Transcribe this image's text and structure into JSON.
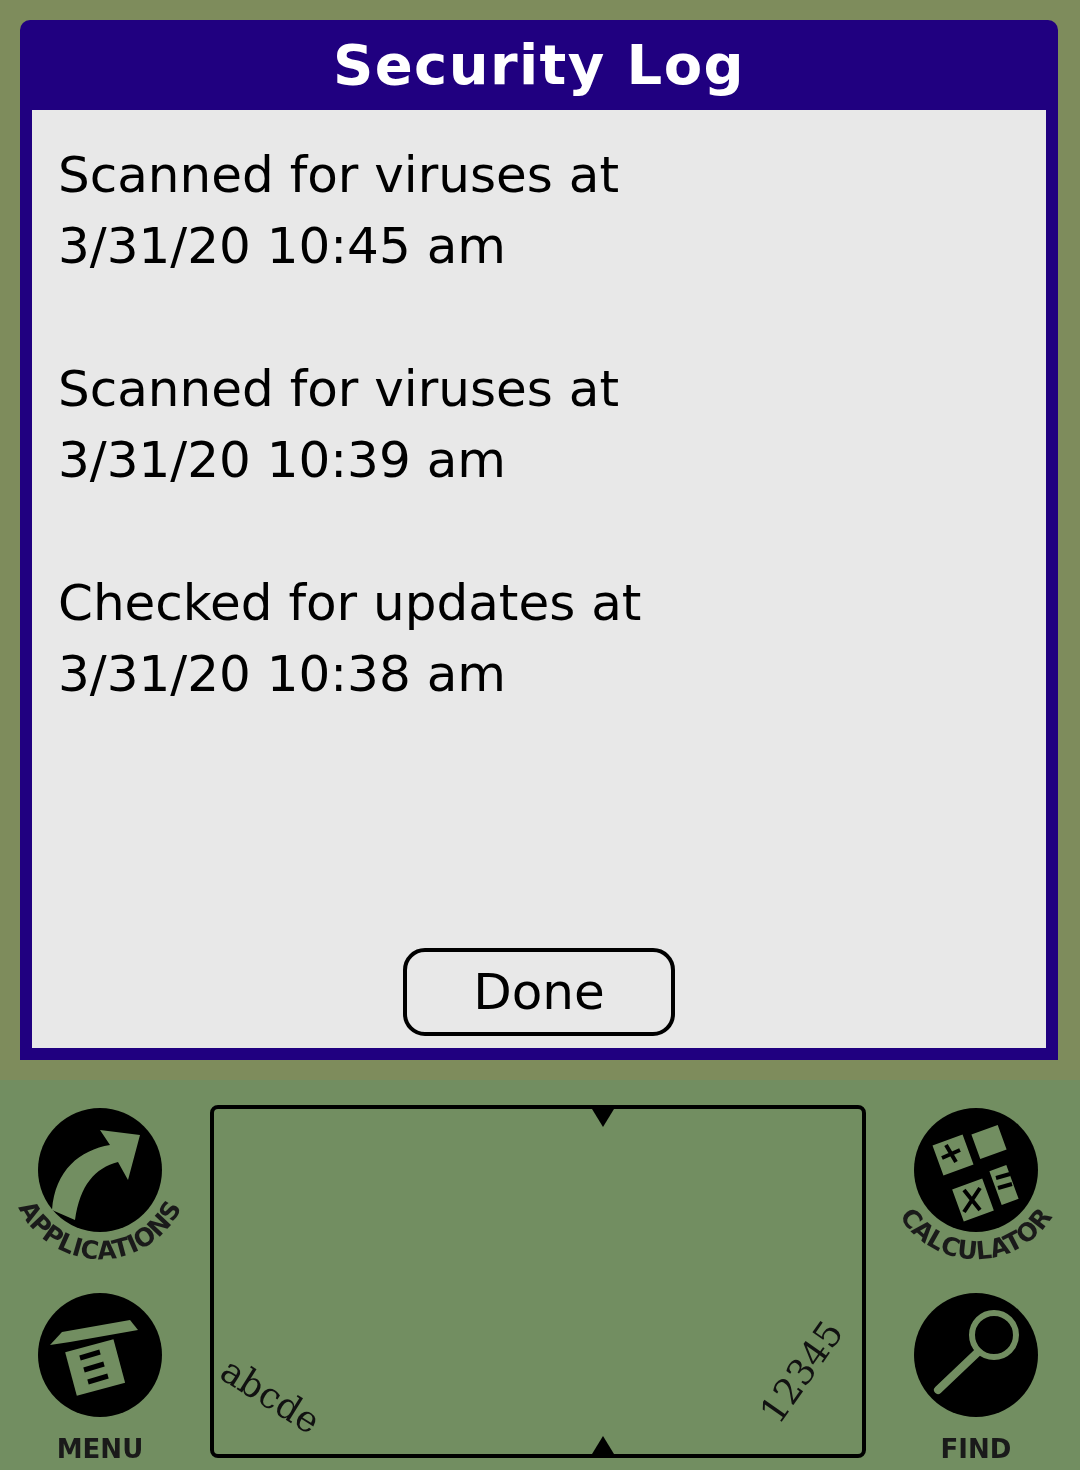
{
  "dialog": {
    "title": "Security Log",
    "entries": [
      {
        "action": "Scanned for viruses at",
        "time": "3/31/20 10:45 am"
      },
      {
        "action": "Scanned for viruses at",
        "time": "3/31/20 10:39 am"
      },
      {
        "action": "Checked for updates at",
        "time": "3/31/20 10:38 am"
      }
    ],
    "button": "Done"
  },
  "silkscreen": {
    "buttons": [
      {
        "label": "APPLICATIONS",
        "kind": "applications"
      },
      {
        "label": "MENU",
        "kind": "menu"
      },
      {
        "label": "CALCULATOR",
        "kind": "calculator"
      },
      {
        "label": "FIND",
        "kind": "find"
      }
    ],
    "graffiti": {
      "letters_label": "abcde",
      "numbers_label": "12345"
    }
  }
}
